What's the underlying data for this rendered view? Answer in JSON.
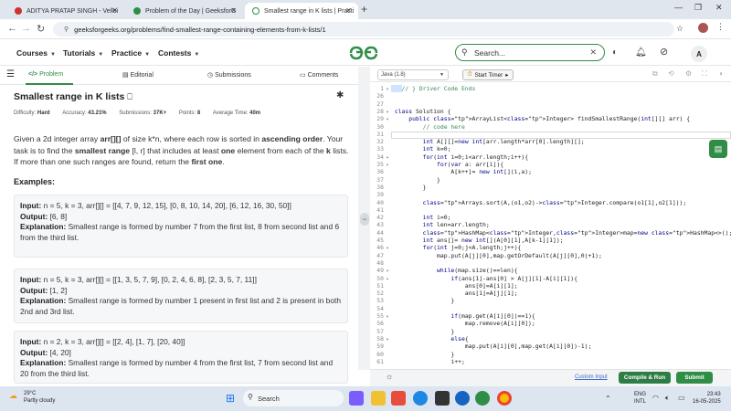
{
  "browser": {
    "tabs": [
      {
        "title": "ADITYA PRATAP SINGH - Velloi"
      },
      {
        "title": "Problem of the Day | GeeksforG"
      },
      {
        "title": "Smallest range in K lists | Practi"
      }
    ],
    "url": "geeksforgeeks.org/problems/find-smallest-range-containing-elements-from-k-lists/1"
  },
  "site": {
    "nav": [
      "Courses",
      "Tutorials",
      "Practice",
      "Contests"
    ],
    "search_placeholder": "Search...",
    "user_initial": "A",
    "brand_color": "#2f8d46"
  },
  "problem_tabs": [
    "Problem",
    "Editorial",
    "Submissions",
    "Comments"
  ],
  "problem": {
    "title": "Smallest range in K lists",
    "difficulty_label": "Difficulty:",
    "difficulty": "Hard",
    "accuracy_label": "Accuracy:",
    "accuracy": "43.21%",
    "submissions_label": "Submissions:",
    "submissions": "37K+",
    "points_label": "Points:",
    "points": "8",
    "time_label": "Average Time:",
    "time": "40m",
    "desc": {
      "p1": "Given a 2d integer array ",
      "p1b": "arr[][]",
      "p2": " of size k*n, where each row is sorted in ",
      "p2b": "ascending order",
      "p3": ". Your task is to find the ",
      "p3b": "smallest range",
      "p4": " [l, r] that includes at least ",
      "p4b": "one",
      "p5": " element from each of the ",
      "p5b": "k",
      "p6": " lists. If more than one such ranges are found, return the ",
      "p6b": "first one",
      "p7": "."
    },
    "examples_heading": "Examples:",
    "input_label": "Input:",
    "output_label": "Output:",
    "explanation_label": "Explanation:",
    "examples": [
      {
        "input": "n = 5, k = 3, arr[][] = [[4, 7, 9, 12, 15], [0, 8, 10, 14, 20], [6, 12, 16, 30, 50]]",
        "output": "[6, 8]",
        "explanation": "Smallest range is formed by  number 7 from the first list, 8 from second list and 6 from the third list."
      },
      {
        "input": "n = 5, k = 3, arr[][] = [[1, 3, 5, 7, 9], [0, 2, 4, 6, 8], [2, 3, 5, 7, 11]]",
        "output": "[1, 2]",
        "explanation": "Smallest range is formed by number 1 present in first list and 2 is present in both 2nd and 3rd list."
      },
      {
        "input": "n = 2, k = 3, arr[][] = [[2, 4], [1, 7], [20, 40]]",
        "output": "[4, 20]",
        "explanation": "Smallest range is formed by number 4 from the first list, 7 from second list and 20 from the third list."
      }
    ]
  },
  "editor": {
    "language": "Java (1.8)",
    "timer_label": "Start Timer",
    "custom_input": "Custom Input",
    "compile_label": "Compile & Run",
    "submit_label": "Submit",
    "lines": [
      {
        "n": "1",
        "t": "// } Driver Code Ends"
      },
      {
        "n": "26",
        "t": ""
      },
      {
        "n": "27",
        "t": ""
      },
      {
        "n": "28",
        "t": "class Solution {"
      },
      {
        "n": "29",
        "t": "    public ArrayList<Integer> findSmallestRange(int[][] arr) {"
      },
      {
        "n": "30",
        "t": "        // code here"
      },
      {
        "n": "31",
        "t": ""
      },
      {
        "n": "32",
        "t": "        int A[][]=new int[arr.length*arr[0].length][];"
      },
      {
        "n": "33",
        "t": "        int k=0;"
      },
      {
        "n": "34",
        "t": "        for(int i=0;i<arr.length;i++){"
      },
      {
        "n": "35",
        "t": "            for(var a: arr[i]){"
      },
      {
        "n": "36",
        "t": "                A[k++]= new int[](i,a);"
      },
      {
        "n": "37",
        "t": "            }"
      },
      {
        "n": "38",
        "t": "        }"
      },
      {
        "n": "39",
        "t": ""
      },
      {
        "n": "40",
        "t": "        Arrays.sort(A,(o1,o2)->Integer.compare(o1[1],o2[1]));"
      },
      {
        "n": "41",
        "t": ""
      },
      {
        "n": "42",
        "t": "        int i=0;"
      },
      {
        "n": "43",
        "t": "        int len=arr.length;"
      },
      {
        "n": "44",
        "t": "        HashMap<Integer,Integer>map=new HashMap<>();"
      },
      {
        "n": "45",
        "t": "        int ans[]= new int[](A[0][1],A[k-1][1]);"
      },
      {
        "n": "46",
        "t": "        for(int j=0;j<A.length;j++){"
      },
      {
        "n": "47",
        "t": "            map.put(A[j][0],map.getOrDefault(A[j][0],0)+1);"
      },
      {
        "n": "48",
        "t": ""
      },
      {
        "n": "49",
        "t": "            while(map.size()==len){"
      },
      {
        "n": "50",
        "t": "                if(ans[1]-ans[0] > A[j][1]-A[i][1]){"
      },
      {
        "n": "51",
        "t": "                    ans[0]=A[i][1];"
      },
      {
        "n": "52",
        "t": "                    ans[1]=A[j][1];"
      },
      {
        "n": "53",
        "t": "                }"
      },
      {
        "n": "54",
        "t": ""
      },
      {
        "n": "55",
        "t": "                if(map.get(A[i][0])==1){"
      },
      {
        "n": "56",
        "t": "                    map.remove(A[i][0]);"
      },
      {
        "n": "57",
        "t": "                }"
      },
      {
        "n": "58",
        "t": "                else{"
      },
      {
        "n": "59",
        "t": "                    map.put(A[i][0],map.get(A[i][0])-1);"
      },
      {
        "n": "60",
        "t": "                }"
      },
      {
        "n": "61",
        "t": "                i++;"
      }
    ]
  },
  "taskbar": {
    "temp": "29°C",
    "weather": "Partly cloudy",
    "search": "Search",
    "lang1": "ENG",
    "lang2": "INTL",
    "time": "23:43",
    "date": "16-05-2025"
  }
}
